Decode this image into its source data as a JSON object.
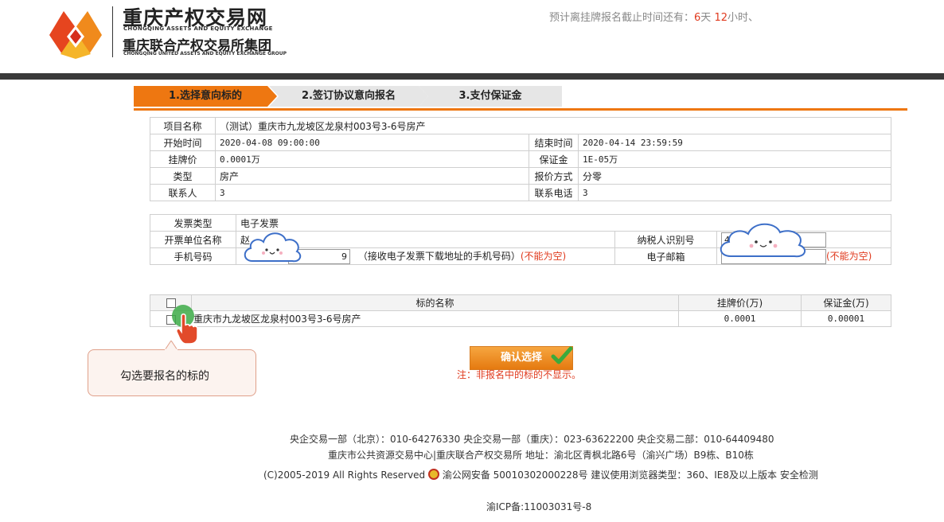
{
  "header": {
    "site_name": "重庆产权交易网",
    "site_name_en": "CHONGQING ASSETS AND EQUITY EXCHANGE",
    "group_name": "重庆联合产权交易所集团",
    "group_name_en": "CHONGQING UNITED ASSETS AND EQUITY EXCHANGE GROUP",
    "countdown_prefix": "预计离挂牌报名截止时间还有：",
    "countdown_days": "6",
    "countdown_days_unit": "天",
    "countdown_hours": "12",
    "countdown_hours_unit": "小时、"
  },
  "steps": [
    "1.选择意向标的",
    "2.签订协议意向报名",
    "3.支付保证金"
  ],
  "project_info": {
    "name_label": "项目名称",
    "name_value": "（测试）重庆市九龙坡区龙泉村003号3-6号房产",
    "start_label": "开始时间",
    "start_value": "2020-04-08 09:00:00",
    "end_label": "结束时间",
    "end_value": "2020-04-14 23:59:59",
    "price_label": "挂牌价",
    "price_value": "0.0001万",
    "deposit_label": "保证金",
    "deposit_value": "1E-05万",
    "type_label": "类型",
    "type_value": "房产",
    "quote_label": "报价方式",
    "quote_value": "分零",
    "contact_label": "联系人",
    "contact_value": "3",
    "phone_label": "联系电话",
    "phone_value": "3"
  },
  "invoice": {
    "type_label": "发票类型",
    "type_value": "电子发票",
    "unit_label": "开票单位名称",
    "unit_value_visible": "赵",
    "tax_label": "纳税人识别号",
    "tax_value_visible": "4",
    "mobile_label": "手机号码",
    "mobile_value_visible": "9",
    "mobile_hint": "（接收电子发票下载地址的手机号码）",
    "required": "(不能为空)",
    "email_label": "电子邮箱"
  },
  "targets": {
    "col_name": "标的名称",
    "col_price": "挂牌价(万)",
    "col_deposit": "保证金(万)",
    "rows": [
      {
        "name": "重庆市九龙坡区龙泉村003号3-6号房产",
        "price": "0.0001",
        "deposit": "0.00001"
      }
    ]
  },
  "callout": "勾选要报名的标的",
  "confirm_label": "确认选择",
  "note": "注：非报名中的标的不显示。",
  "footer": {
    "line1": "央企交易一部（北京）：010-64276330   央企交易一部（重庆）：023-63622200   央企交易二部：010-64409480",
    "line2": "重庆市公共资源交易中心|重庆联合产权交易所 地址：渝北区青枫北路6号（渝兴广场）B9栋、B10栋",
    "line3a": "(C)2005-2019    All Rights Reserved",
    "line3b": "渝公网安备 50010302000228号  建议使用浏览器类型：360、IE8及以上版本 安全检测",
    "line4": "渝ICP备:11003031号-8"
  },
  "colors": {
    "accent": "#ee7711",
    "warning": "#e03a1e",
    "topbar": "#3a3a3a"
  },
  "icons": [
    "logo-mark-icon",
    "checkbox-icon",
    "hand-pointer-icon",
    "check-mark-icon",
    "police-badge-icon",
    "cloud-mask-icon"
  ]
}
